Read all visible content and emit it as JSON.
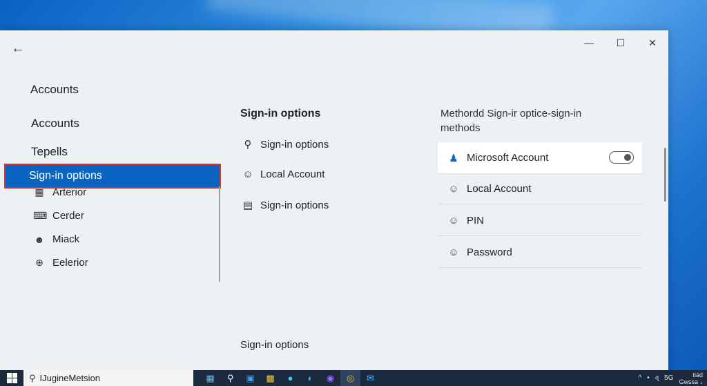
{
  "window": {
    "back_icon": "back-arrow-icon",
    "controls": [
      "minimize-icon",
      "maximize-icon",
      "close-icon"
    ]
  },
  "sidebar": {
    "heading": "Accounts",
    "links": [
      "Accounts",
      "Tepells"
    ],
    "selected": "Sign-in options",
    "items": [
      {
        "label": "Arterior",
        "icon": "grid-icon"
      },
      {
        "label": "Cerder",
        "icon": "keyboard-icon"
      },
      {
        "label": "Miack",
        "icon": "people-icon"
      },
      {
        "label": "Eelerior",
        "icon": "crosshair-icon"
      }
    ]
  },
  "middle": {
    "title": "Sign-in options",
    "items": [
      {
        "label": "Sign-in options",
        "icon": "search-icon"
      },
      {
        "label": "Local Account",
        "icon": "person-icon"
      },
      {
        "label": "Sign-in options",
        "icon": "id-card-icon"
      }
    ],
    "footer": "Sign-in options"
  },
  "right": {
    "title": "Methordd Sign-ir optice-sign-in methods",
    "methods": [
      {
        "label": "Microsoft Account",
        "icon": "person-icon",
        "toggle": "on"
      },
      {
        "label": "Local Account",
        "icon": "person-icon"
      },
      {
        "label": "PIN",
        "icon": "person-icon"
      },
      {
        "label": "Password",
        "icon": "person-icon"
      }
    ]
  },
  "taskbar": {
    "search_text": "IJugineMetsion",
    "apps": [
      "windows-icon",
      "search-icon",
      "file-explorer-icon",
      "folder-icon",
      "store-icon",
      "edge-icon",
      "app-icon",
      "chrome-icon",
      "mail-icon"
    ],
    "tray": {
      "symbols": [
        "^",
        "•",
        "‹ʅ",
        "5G"
      ],
      "clock_line1": "tiád",
      "clock_line2": "Gwssa ↓"
    }
  }
}
